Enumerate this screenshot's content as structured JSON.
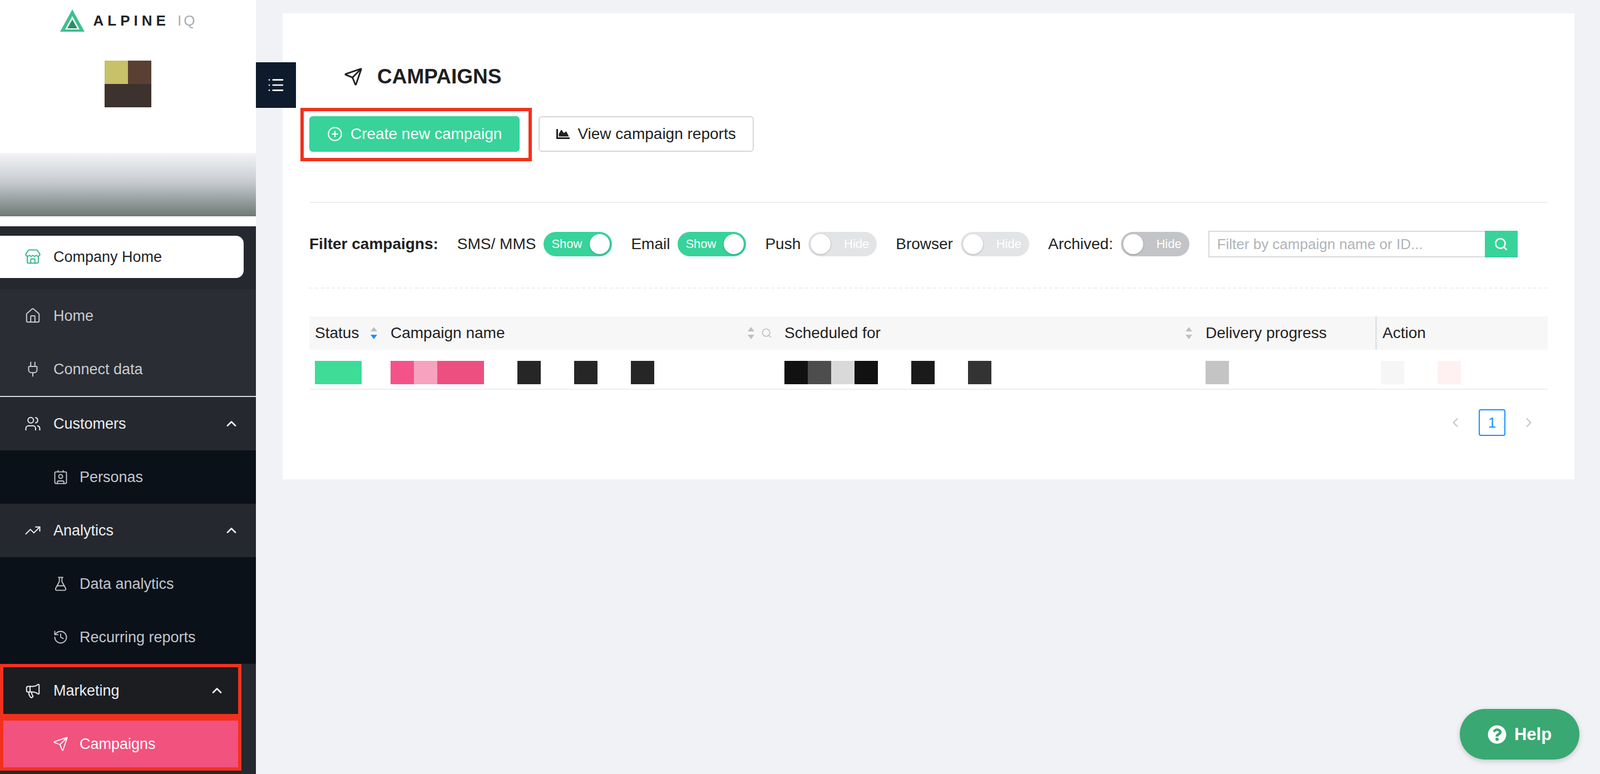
{
  "sidebar": {
    "logo": {
      "name": "ALPINE",
      "suffix": "IQ"
    },
    "items": [
      {
        "label": "Company Home",
        "kind": "pill",
        "selected": true,
        "expanded": false,
        "annotated": false
      },
      {
        "label": "Home",
        "kind": "link",
        "selected": false,
        "expanded": false,
        "annotated": false
      },
      {
        "label": "Connect data",
        "kind": "link",
        "selected": false,
        "expanded": false,
        "annotated": false
      },
      {
        "label": "Customers",
        "kind": "section",
        "selected": false,
        "expanded": true,
        "annotated": false
      },
      {
        "label": "Personas",
        "kind": "sub",
        "selected": false,
        "expanded": false,
        "annotated": false
      },
      {
        "label": "Analytics",
        "kind": "section",
        "selected": false,
        "expanded": true,
        "annotated": false
      },
      {
        "label": "Data analytics",
        "kind": "sub",
        "selected": false,
        "expanded": false,
        "annotated": false
      },
      {
        "label": "Recurring reports",
        "kind": "sub",
        "selected": false,
        "expanded": false,
        "annotated": false
      },
      {
        "label": "Marketing",
        "kind": "section",
        "selected": false,
        "expanded": true,
        "annotated": true
      },
      {
        "label": "Campaigns",
        "kind": "sub",
        "selected": true,
        "expanded": false,
        "annotated": true
      }
    ]
  },
  "page": {
    "title": "CAMPAIGNS",
    "actions": [
      {
        "label": "Create new campaign",
        "kind": "primary",
        "annotated": true
      },
      {
        "label": "View campaign reports",
        "kind": "secondary",
        "annotated": false
      }
    ]
  },
  "filters": {
    "label": "Filter campaigns:",
    "toggles": [
      {
        "label": "SMS/ MMS",
        "on": true,
        "disabled": false,
        "text": "Show"
      },
      {
        "label": "Email",
        "on": true,
        "disabled": false,
        "text": "Show"
      },
      {
        "label": "Push",
        "on": false,
        "disabled": true,
        "text": "Hide"
      },
      {
        "label": "Browser",
        "on": false,
        "disabled": true,
        "text": "Hide"
      },
      {
        "label": "Archived:",
        "on": false,
        "disabled": false,
        "text": "Hide"
      }
    ],
    "search": {
      "placeholder": "Filter by campaign name or ID..."
    }
  },
  "table": {
    "columns": [
      {
        "label": "Status",
        "sortable": true,
        "sort": "desc",
        "searchable": false
      },
      {
        "label": "Campaign name",
        "sortable": true,
        "sort": "none",
        "searchable": true
      },
      {
        "label": "Scheduled for",
        "sortable": true,
        "sort": "none",
        "searchable": false
      },
      {
        "label": "Delivery progress",
        "sortable": false,
        "sort": "none",
        "searchable": false
      },
      {
        "label": "Action",
        "sortable": false,
        "sort": "none",
        "searchable": false
      }
    ],
    "rows": [
      {
        "redacted": true,
        "cells": [
          {
            "groups": [
              [
                "#3ddc97",
                "#3ddc97"
              ]
            ]
          },
          {
            "groups": [
              [
                "#f45389",
                "#f7a3bf",
                "#ee4f81",
                "#ee4f81"
              ],
              [
                "#262626"
              ],
              [
                "#262626"
              ],
              [
                "#262626"
              ]
            ]
          },
          {
            "groups": [
              [
                "#111111",
                "#4d4d4d",
                "#d9d9d9",
                "#111111"
              ],
              [
                "#1a1a1a"
              ],
              [
                "#333333"
              ]
            ]
          },
          {
            "groups": [
              [
                "#c4c4c4"
              ]
            ]
          },
          {
            "groups": [
              [
                "#f6f6f6"
              ],
              [
                "#fff1f1"
              ]
            ]
          }
        ]
      }
    ]
  },
  "pagination": {
    "pages": [
      {
        "label": "1",
        "selected": true
      }
    ],
    "prev_disabled": true,
    "next_disabled": true
  },
  "help": {
    "label": "Help"
  }
}
